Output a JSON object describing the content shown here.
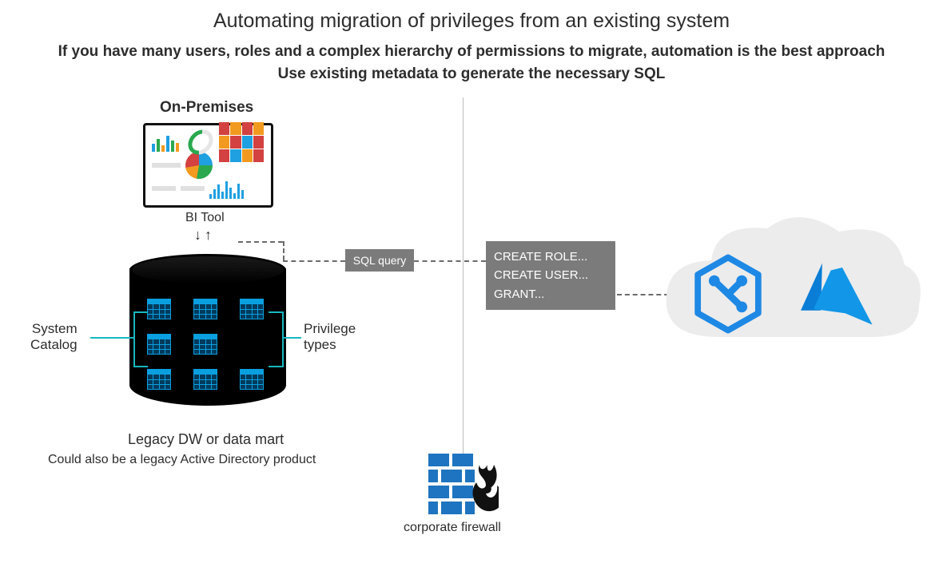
{
  "title": "Automating migration of privileges from an existing system",
  "subtitle_line1": "If you have many users, roles and a complex hierarchy of permissions to migrate, automation is the best approach",
  "subtitle_line2": "Use existing metadata to generate the necessary SQL",
  "on_premises_label": "On-Premises",
  "bi_tool_label": "BI Tool",
  "legacy_label": "Legacy DW or data mart",
  "legacy_sub_label": "Could also be a legacy Active Directory product",
  "system_catalog_label_line1": "System",
  "system_catalog_label_line2": "Catalog",
  "privilege_types_label_line1": "Privilege",
  "privilege_types_label_line2": "types",
  "sql_query_label": "SQL query",
  "statements": {
    "line1": "CREATE ROLE...",
    "line2": "CREATE USER...",
    "line3": "GRANT..."
  },
  "firewall_label": "corporate firewall"
}
